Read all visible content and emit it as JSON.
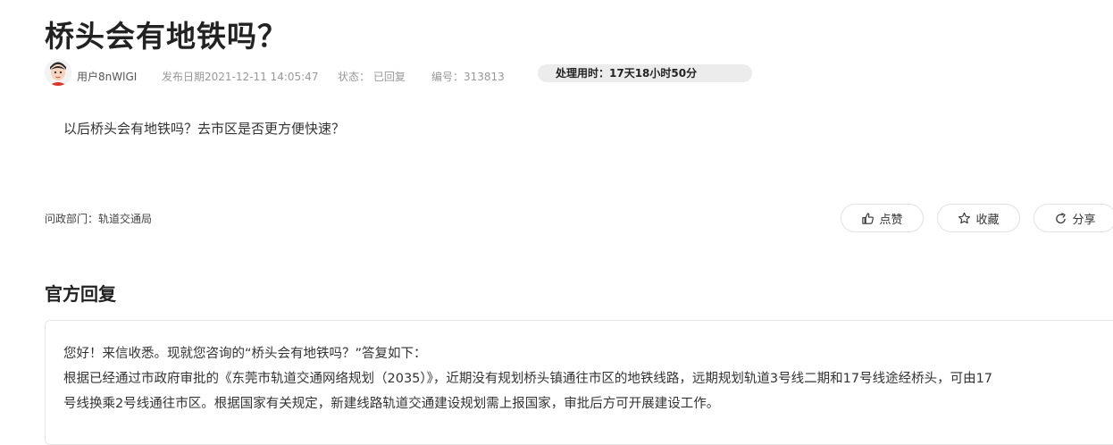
{
  "title": "桥头会有地铁吗？",
  "meta": {
    "username": "用户8nWlGI",
    "publish_date": "发布日期2021-12-11 14:05:47",
    "status": "状态： 已回复",
    "number": "编号：313813",
    "processing_time": "处理用时：17天18小时50分"
  },
  "question_text": "以后桥头会有地铁吗？去市区是否更方便快速？",
  "department": "问政部门：轨道交通局",
  "actions": {
    "like": "点赞",
    "favorite": "收藏",
    "share": "分享"
  },
  "reply": {
    "section_title": "官方回复",
    "line1": "您好！来信收悉。现就您咨询的“桥头会有地铁吗？”答复如下：",
    "line2": "根据已经通过市政府审批的《东莞市轨道交通网络规划（2035）》，近期没有规划桥头镇通往市区的地铁线路，远期规划轨道3号线二期和17号线途经桥头，可由17",
    "line3": "号线换乘2号线通往市区。根据国家有关规定，新建线路轨道交通建设规划需上报国家，审批后方可开展建设工作。"
  }
}
